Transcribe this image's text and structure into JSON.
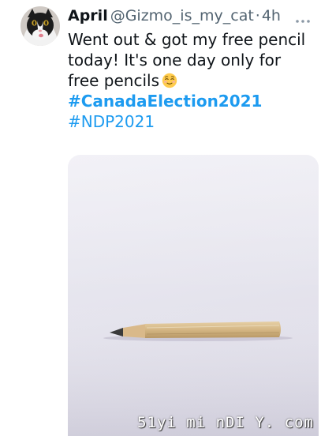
{
  "tweet": {
    "author": {
      "display_name": "April",
      "handle": "@Gizmo_is_my_cat",
      "avatar_icon": "cat-avatar"
    },
    "separator": "·",
    "timestamp": "4h",
    "more_icon": "more-horizontal-icon",
    "text_lines": [
      "Went out & got my free pencil",
      "today! It's one day only for",
      "free pencils"
    ],
    "emoji": "😌",
    "hashtags": [
      "#CanadaElection2021",
      "#NDP2021"
    ],
    "media": {
      "watermark": "51yi mi nDI Y. com"
    }
  },
  "colors": {
    "text": "#0f1419",
    "secondary": "#536471",
    "link": "#1d9bf0"
  }
}
